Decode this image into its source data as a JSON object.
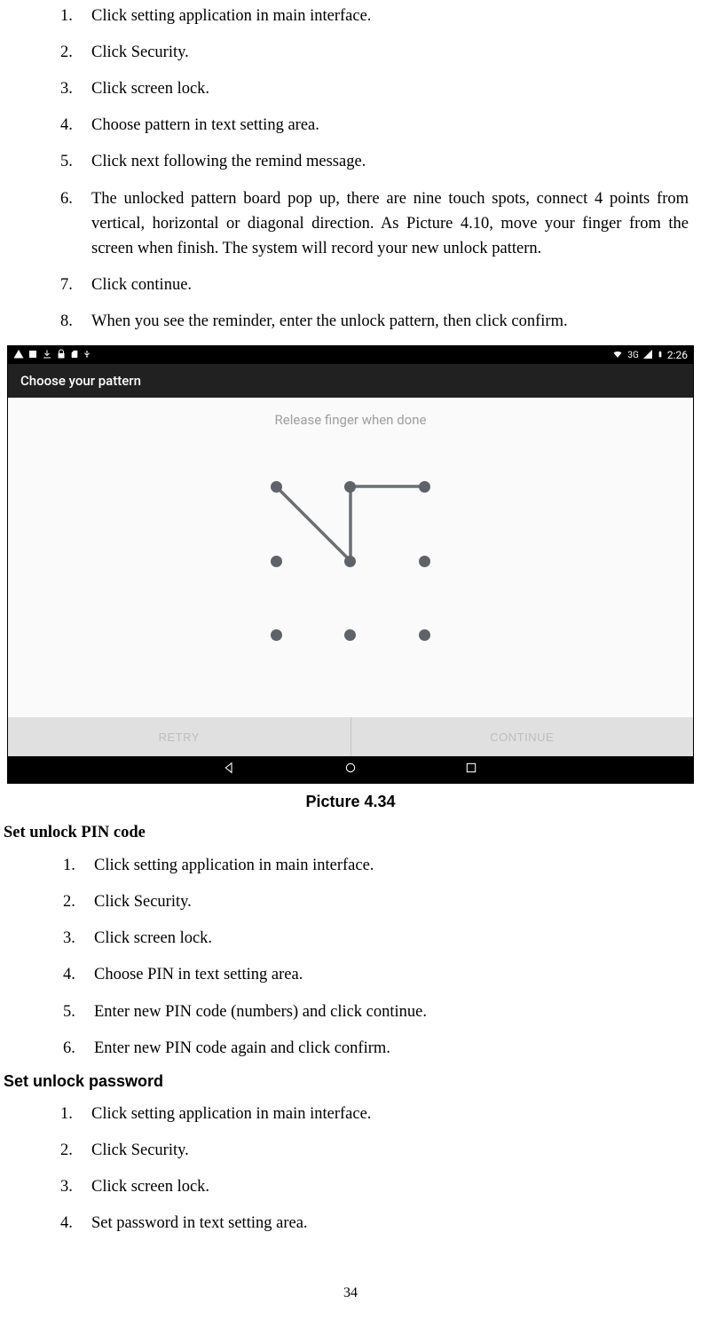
{
  "list1": [
    {
      "n": "1.",
      "t": "Click setting application in main interface."
    },
    {
      "n": "2.",
      "t": "Click Security."
    },
    {
      "n": "3.",
      "t": "Click screen lock."
    },
    {
      "n": "4.",
      "t": "Choose pattern in text setting area."
    },
    {
      "n": "5.",
      "t": "Click next following the remind message."
    },
    {
      "n": "6.",
      "t": "The unlocked pattern board pop up, there are nine touch spots, connect 4 points from vertical, horizontal or diagonal direction. As Picture 4.10, move your finger from the screen when finish. The system will record your new unlock pattern."
    },
    {
      "n": "7.",
      "t": "Click continue."
    },
    {
      "n": "8.",
      "t": "When you see the reminder, enter the unlock pattern, then click confirm."
    }
  ],
  "heading_pin": "Set unlock PIN code",
  "list2": [
    {
      "n": "1.",
      "t": "Click setting application in main interface."
    },
    {
      "n": "2.",
      "t": "Click Security."
    },
    {
      "n": "3.",
      "t": "Click screen lock."
    },
    {
      "n": "4.",
      "t": "Choose PIN in text setting area."
    },
    {
      "n": "5.",
      "t": "Enter new PIN code (numbers) and click continue."
    },
    {
      "n": "6.",
      "t": "Enter new PIN code again and click confirm."
    }
  ],
  "heading_pw": "Set unlock password",
  "list3": [
    {
      "n": "1.",
      "t": "Click setting application in main interface."
    },
    {
      "n": "2.",
      "t": "Click Security."
    },
    {
      "n": "3.",
      "t": "Click screen lock."
    },
    {
      "n": "4.",
      "t": "Set password in text setting area."
    }
  ],
  "caption": "Picture 4.34",
  "page_number": "34",
  "screenshot": {
    "status_time": "2:26",
    "status_net": "3G",
    "title": "Choose your pattern",
    "hint": "Release finger when done",
    "btn_retry": "RETRY",
    "btn_continue": "CONTINUE"
  }
}
